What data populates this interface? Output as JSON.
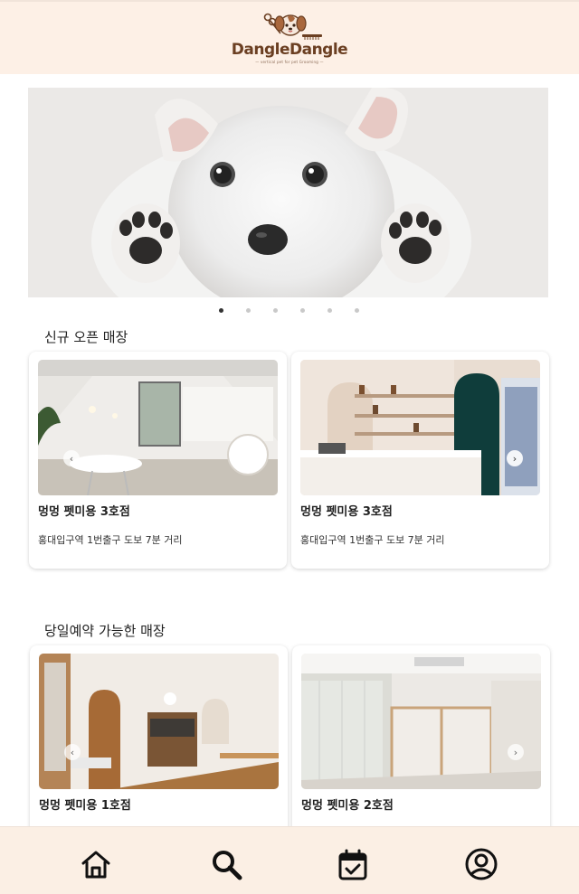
{
  "header": {
    "logo_text": "DangleDangle",
    "logo_tagline": "— vertical pet for pet Grooming —"
  },
  "banner": {
    "slide_count": 6,
    "active_index": 0
  },
  "sections": {
    "new": {
      "title": "신규 오픈 매장",
      "cards": [
        {
          "name": "멍멍 펫미용 3호점",
          "desc": "홍대입구역 1번출구 도보 7분 거리"
        },
        {
          "name": "멍멍 펫미용 3호점",
          "desc": "홍대입구역 1번출구 도보 7분 거리"
        }
      ]
    },
    "today": {
      "title": "당일예약 가능한 매장",
      "cards": [
        {
          "name": "멍멍 펫미용 1호점"
        },
        {
          "name": "멍멍 펫미용 2호점"
        }
      ]
    }
  },
  "nav": {
    "items": [
      "home-icon",
      "search-icon",
      "calendar-check-icon",
      "user-circle-icon"
    ]
  },
  "colors": {
    "header_bg": "#fdf0e6",
    "nav_bg": "#fbefe4",
    "brand": "#6b3f22"
  }
}
